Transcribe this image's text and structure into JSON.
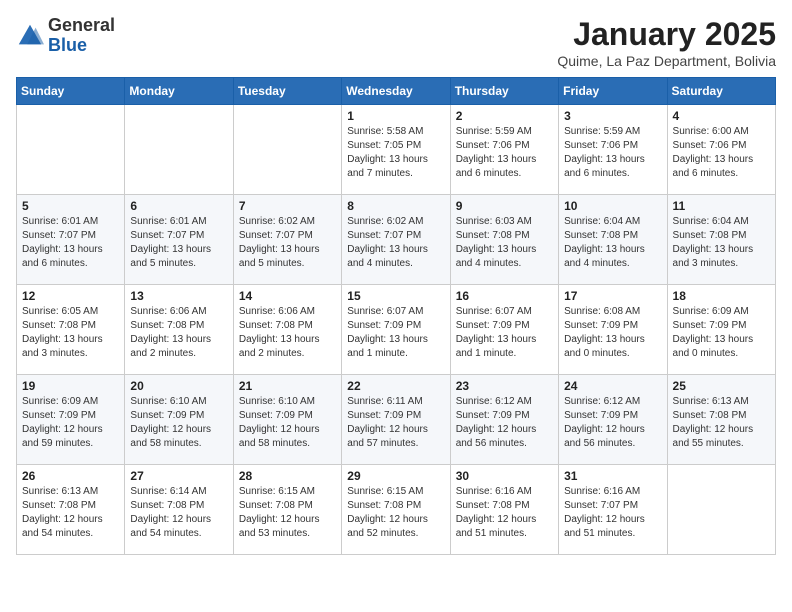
{
  "header": {
    "logo_general": "General",
    "logo_blue": "Blue",
    "title": "January 2025",
    "location": "Quime, La Paz Department, Bolivia"
  },
  "days_of_week": [
    "Sunday",
    "Monday",
    "Tuesday",
    "Wednesday",
    "Thursday",
    "Friday",
    "Saturday"
  ],
  "weeks": [
    [
      {
        "day": "",
        "info": ""
      },
      {
        "day": "",
        "info": ""
      },
      {
        "day": "",
        "info": ""
      },
      {
        "day": "1",
        "info": "Sunrise: 5:58 AM\nSunset: 7:05 PM\nDaylight: 13 hours\nand 7 minutes."
      },
      {
        "day": "2",
        "info": "Sunrise: 5:59 AM\nSunset: 7:06 PM\nDaylight: 13 hours\nand 6 minutes."
      },
      {
        "day": "3",
        "info": "Sunrise: 5:59 AM\nSunset: 7:06 PM\nDaylight: 13 hours\nand 6 minutes."
      },
      {
        "day": "4",
        "info": "Sunrise: 6:00 AM\nSunset: 7:06 PM\nDaylight: 13 hours\nand 6 minutes."
      }
    ],
    [
      {
        "day": "5",
        "info": "Sunrise: 6:01 AM\nSunset: 7:07 PM\nDaylight: 13 hours\nand 6 minutes."
      },
      {
        "day": "6",
        "info": "Sunrise: 6:01 AM\nSunset: 7:07 PM\nDaylight: 13 hours\nand 5 minutes."
      },
      {
        "day": "7",
        "info": "Sunrise: 6:02 AM\nSunset: 7:07 PM\nDaylight: 13 hours\nand 5 minutes."
      },
      {
        "day": "8",
        "info": "Sunrise: 6:02 AM\nSunset: 7:07 PM\nDaylight: 13 hours\nand 4 minutes."
      },
      {
        "day": "9",
        "info": "Sunrise: 6:03 AM\nSunset: 7:08 PM\nDaylight: 13 hours\nand 4 minutes."
      },
      {
        "day": "10",
        "info": "Sunrise: 6:04 AM\nSunset: 7:08 PM\nDaylight: 13 hours\nand 4 minutes."
      },
      {
        "day": "11",
        "info": "Sunrise: 6:04 AM\nSunset: 7:08 PM\nDaylight: 13 hours\nand 3 minutes."
      }
    ],
    [
      {
        "day": "12",
        "info": "Sunrise: 6:05 AM\nSunset: 7:08 PM\nDaylight: 13 hours\nand 3 minutes."
      },
      {
        "day": "13",
        "info": "Sunrise: 6:06 AM\nSunset: 7:08 PM\nDaylight: 13 hours\nand 2 minutes."
      },
      {
        "day": "14",
        "info": "Sunrise: 6:06 AM\nSunset: 7:08 PM\nDaylight: 13 hours\nand 2 minutes."
      },
      {
        "day": "15",
        "info": "Sunrise: 6:07 AM\nSunset: 7:09 PM\nDaylight: 13 hours\nand 1 minute."
      },
      {
        "day": "16",
        "info": "Sunrise: 6:07 AM\nSunset: 7:09 PM\nDaylight: 13 hours\nand 1 minute."
      },
      {
        "day": "17",
        "info": "Sunrise: 6:08 AM\nSunset: 7:09 PM\nDaylight: 13 hours\nand 0 minutes."
      },
      {
        "day": "18",
        "info": "Sunrise: 6:09 AM\nSunset: 7:09 PM\nDaylight: 13 hours\nand 0 minutes."
      }
    ],
    [
      {
        "day": "19",
        "info": "Sunrise: 6:09 AM\nSunset: 7:09 PM\nDaylight: 12 hours\nand 59 minutes."
      },
      {
        "day": "20",
        "info": "Sunrise: 6:10 AM\nSunset: 7:09 PM\nDaylight: 12 hours\nand 58 minutes."
      },
      {
        "day": "21",
        "info": "Sunrise: 6:10 AM\nSunset: 7:09 PM\nDaylight: 12 hours\nand 58 minutes."
      },
      {
        "day": "22",
        "info": "Sunrise: 6:11 AM\nSunset: 7:09 PM\nDaylight: 12 hours\nand 57 minutes."
      },
      {
        "day": "23",
        "info": "Sunrise: 6:12 AM\nSunset: 7:09 PM\nDaylight: 12 hours\nand 56 minutes."
      },
      {
        "day": "24",
        "info": "Sunrise: 6:12 AM\nSunset: 7:09 PM\nDaylight: 12 hours\nand 56 minutes."
      },
      {
        "day": "25",
        "info": "Sunrise: 6:13 AM\nSunset: 7:08 PM\nDaylight: 12 hours\nand 55 minutes."
      }
    ],
    [
      {
        "day": "26",
        "info": "Sunrise: 6:13 AM\nSunset: 7:08 PM\nDaylight: 12 hours\nand 54 minutes."
      },
      {
        "day": "27",
        "info": "Sunrise: 6:14 AM\nSunset: 7:08 PM\nDaylight: 12 hours\nand 54 minutes."
      },
      {
        "day": "28",
        "info": "Sunrise: 6:15 AM\nSunset: 7:08 PM\nDaylight: 12 hours\nand 53 minutes."
      },
      {
        "day": "29",
        "info": "Sunrise: 6:15 AM\nSunset: 7:08 PM\nDaylight: 12 hours\nand 52 minutes."
      },
      {
        "day": "30",
        "info": "Sunrise: 6:16 AM\nSunset: 7:08 PM\nDaylight: 12 hours\nand 51 minutes."
      },
      {
        "day": "31",
        "info": "Sunrise: 6:16 AM\nSunset: 7:07 PM\nDaylight: 12 hours\nand 51 minutes."
      },
      {
        "day": "",
        "info": ""
      }
    ]
  ]
}
